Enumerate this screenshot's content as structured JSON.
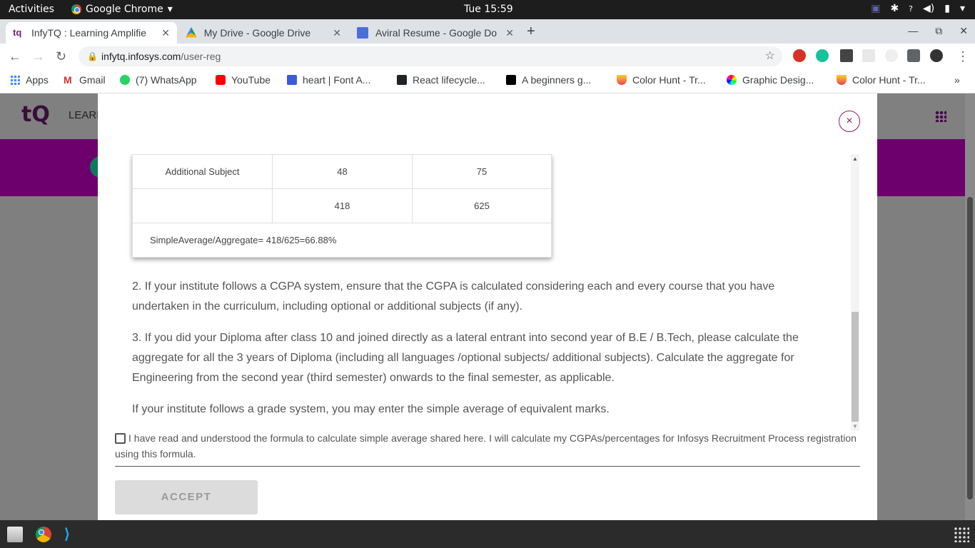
{
  "topbar": {
    "activities": "Activities",
    "app_name": "Google Chrome",
    "clock": "Tue 15:59"
  },
  "tabs": [
    {
      "title": "InfyTQ : Learning Amplifie",
      "active": true
    },
    {
      "title": "My Drive - Google Drive",
      "active": false
    },
    {
      "title": "Aviral Resume - Google Do",
      "active": false
    }
  ],
  "address": {
    "host": "infytq.infosys.com",
    "path": "/user-reg"
  },
  "bookmarks": [
    "Apps",
    "Gmail",
    "(7) WhatsApp",
    "YouTube",
    "heart | Font A...",
    "React lifecycle...",
    "A beginners g...",
    "Color Hunt - Tr...",
    "Graphic Desig...",
    "Color Hunt - Tr..."
  ],
  "page": {
    "logo": "tQ",
    "nav_label": "LEARI"
  },
  "modal": {
    "table": {
      "rows": [
        {
          "subject": "Additional Subject",
          "obtained": "48",
          "max": "75"
        },
        {
          "subject": "",
          "obtained": "418",
          "max": "625"
        }
      ],
      "aggregate": "SimpleAverage/Aggregate= 418/625=66.88%"
    },
    "para2": "2. If your institute follows a CGPA system, ensure that the CGPA is calculated considering each and every course that you have undertaken in the curriculum, including optional or additional subjects (if any).",
    "para3": "3. If you did your Diploma after class 10 and joined directly as a lateral entrant into second year of B.E / B.Tech, please calculate the aggregate for all the 3 years of Diploma (including all languages /optional subjects/ additional subjects). Calculate the aggregate for Engineering from the second year (third semester) onwards to the final semester, as applicable.",
    "para4": "If your institute follows a grade system, you may enter the simple average of equivalent marks.",
    "agreement": "I have read and understood the formula to calculate simple average shared here. I will calculate my CGPAs/percentages for Infosys Recruitment Process registration using this formula.",
    "accept_label": "ACCEPT",
    "close_label": "×"
  }
}
